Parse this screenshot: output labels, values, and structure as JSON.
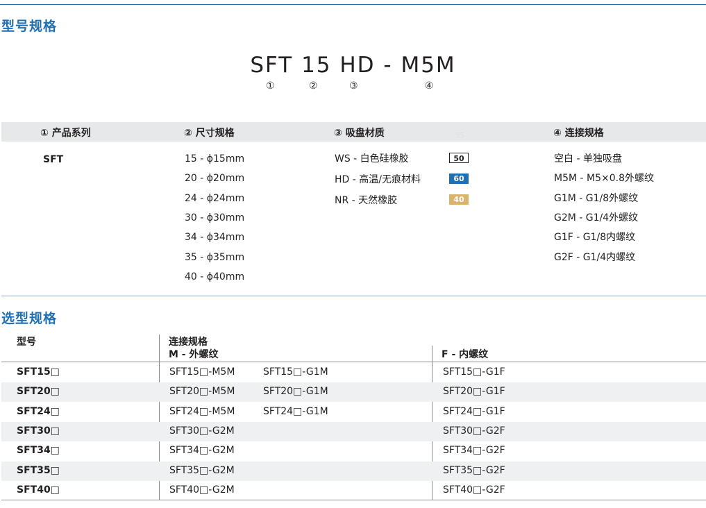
{
  "section_titles": {
    "model_spec": "型号规格",
    "selection_spec": "选型规格"
  },
  "model_code": "SFT 15 HD - M5M",
  "code_markers": [
    "①",
    "②",
    "③",
    "④"
  ],
  "code_columns": {
    "headers": [
      "① 产品系列",
      "② 尺寸规格",
      "③ 吸盘材质",
      "④ 连接规格"
    ],
    "watermark": "55",
    "series": [
      "SFT"
    ],
    "sizes": [
      "15 - ϕ15mm",
      "20 - ϕ20mm",
      "24 - ϕ24mm",
      "30 - ϕ30mm",
      "34 - ϕ34mm",
      "35 - ϕ35mm",
      "40 - ϕ40mm"
    ],
    "materials": [
      {
        "label": "WS - 白色硅橡胶",
        "hardness": "50",
        "style": "outline"
      },
      {
        "label": "HD - 高温/无痕材料",
        "hardness": "60",
        "style": "blue",
        "color": "#1f6fb5"
      },
      {
        "label": "NR - 天然橡胶",
        "hardness": "40",
        "style": "gold",
        "color": "#d9b46a"
      }
    ],
    "connections": [
      "空白 - 单独吸盘",
      "M5M - M5×0.8外螺纹",
      "G1M - G1/8外螺纹",
      "G2M - G1/4外螺纹",
      "G1F  - G1/8内螺纹",
      "G2F  - G1/4内螺纹"
    ]
  },
  "selection_table": {
    "header_model": "型号",
    "header_connection": "连接规格",
    "header_male": "M - 外螺纹",
    "header_female": "F - 内螺纹",
    "rows": [
      {
        "model": "SFT15□",
        "male1": "SFT15□-M5M",
        "male2": "SFT15□-G1M",
        "female": "SFT15□-G1F"
      },
      {
        "model": "SFT20□",
        "male1": "SFT20□-M5M",
        "male2": "SFT20□-G1M",
        "female": "SFT20□-G1F"
      },
      {
        "model": "SFT24□",
        "male1": "SFT24□-M5M",
        "male2": "SFT24□-G1M",
        "female": "SFT24□-G1F"
      },
      {
        "model": "SFT30□",
        "male1": "SFT30□-G2M",
        "male2": "",
        "female": "SFT30□-G2F"
      },
      {
        "model": "SFT34□",
        "male1": "SFT34□-G2M",
        "male2": "",
        "female": "SFT34□-G2F"
      },
      {
        "model": "SFT35□",
        "male1": "SFT35□-G2M",
        "male2": "",
        "female": "SFT35□-G2F"
      },
      {
        "model": "SFT40□",
        "male1": "SFT40□-G2M",
        "male2": "",
        "female": "SFT40□-G2F"
      }
    ]
  },
  "colors": {
    "accent": "#1f6fb5",
    "header_bg": "#e7e8e9",
    "row_alt_bg": "#eef0f1"
  }
}
